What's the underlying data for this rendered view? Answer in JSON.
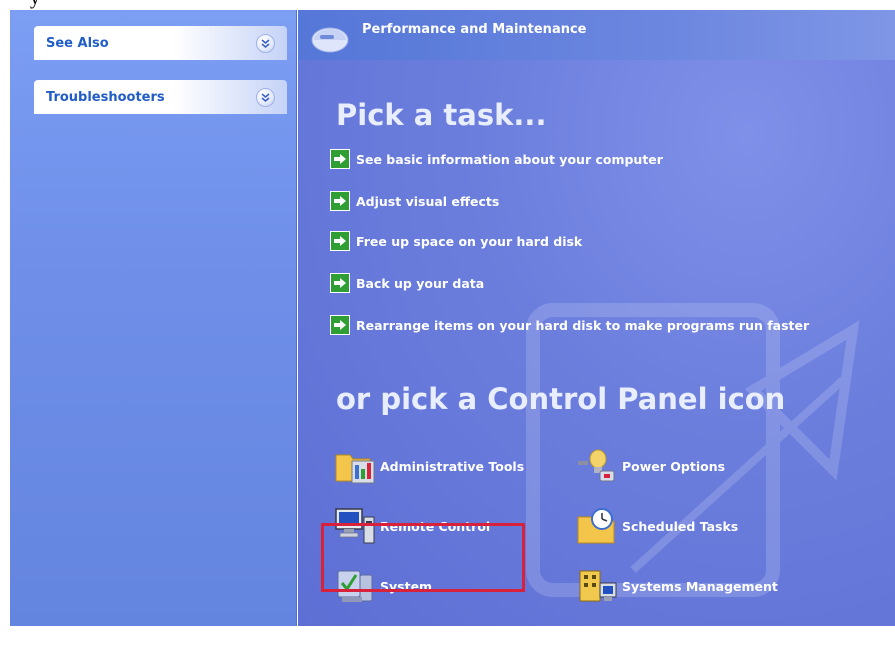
{
  "sidebar": {
    "groups": [
      {
        "title": "See Also"
      },
      {
        "title": "Troubleshooters"
      }
    ]
  },
  "header": {
    "title": "Performance and Maintenance"
  },
  "main": {
    "pick_task_title": "Pick a task...",
    "tasks": [
      {
        "label": "See basic information about your computer"
      },
      {
        "label": "Adjust visual effects"
      },
      {
        "label": "Free up space on your hard disk"
      },
      {
        "label": "Back up your data"
      },
      {
        "label": "Rearrange items on your hard disk to make programs run faster"
      }
    ],
    "or_pick_title": "or pick a Control Panel icon",
    "icons": [
      {
        "label": "Administrative Tools",
        "icon": "administrative-tools-icon"
      },
      {
        "label": "Power Options",
        "icon": "power-options-icon"
      },
      {
        "label": "Remote Control",
        "icon": "remote-control-icon"
      },
      {
        "label": "Scheduled Tasks",
        "icon": "scheduled-tasks-icon"
      },
      {
        "label": "System",
        "icon": "system-icon"
      },
      {
        "label": "Systems Management",
        "icon": "systems-management-icon"
      }
    ]
  },
  "colors": {
    "sidebar_bg": "#6f8fe9",
    "content_bg": "#6b7ddc",
    "link_text": "#215dc6",
    "task_arrow": "#2f9e33",
    "highlight": "#d8213a"
  }
}
